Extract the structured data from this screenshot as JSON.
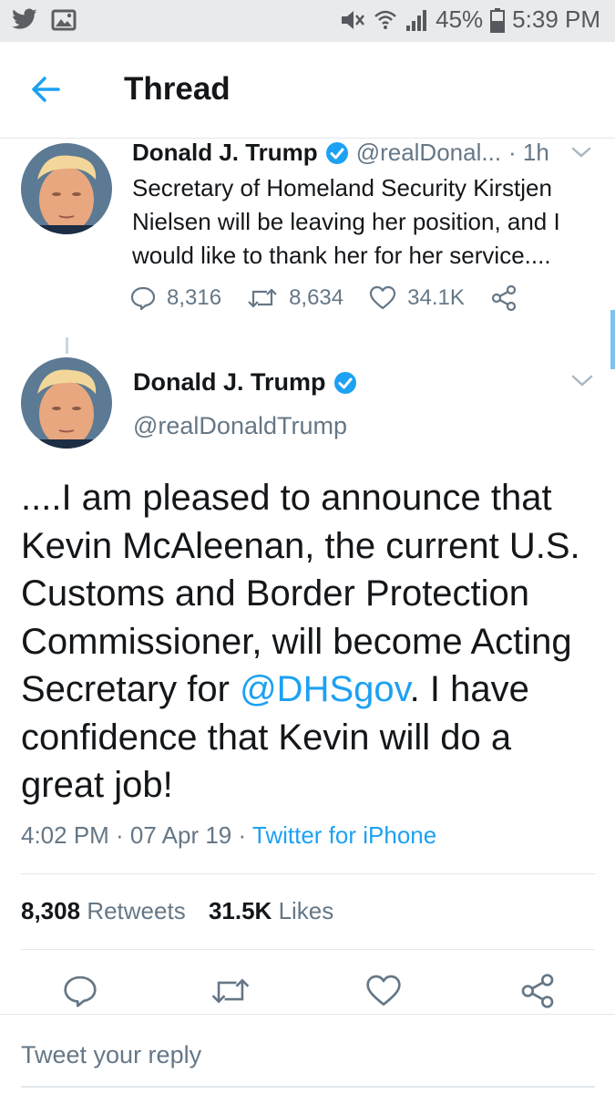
{
  "status_bar": {
    "battery": "45%",
    "time": "5:39 PM"
  },
  "header": {
    "title": "Thread"
  },
  "parent_tweet": {
    "name": "Donald J. Trump",
    "handle": "@realDonal...",
    "time": "· 1h",
    "text": "Secretary of Homeland Security Kirstjen Nielsen will be leaving her position, and I would like to thank her for her service....",
    "replies": "8,316",
    "retweets": "8,634",
    "likes": "34.1K"
  },
  "main_tweet": {
    "name": "Donald J. Trump",
    "handle": "@realDonaldTrump",
    "text_before": "....I am pleased to announce that Kevin McAleenan, the current U.S. Customs and Border Protection Commissioner, will become Acting Secretary for ",
    "mention": "@DHSgov",
    "text_after": ". I have confidence that Kevin will do a great job!",
    "timestamp": "4:02 PM · 07 Apr 19 · ",
    "source": "Twitter for iPhone",
    "retweet_count": "8,308",
    "retweet_label": "Retweets",
    "like_count": "31.5K",
    "like_label": "Likes"
  },
  "reply": {
    "placeholder": "Tweet your reply"
  },
  "colors": {
    "accent": "#1da1f2",
    "muted": "#657786",
    "text": "#14171a",
    "status_bar": "#e9eaeb"
  },
  "icons": [
    "twitter-icon",
    "image-icon",
    "mute-icon",
    "wifi-icon",
    "signal-icon",
    "battery-icon",
    "back-arrow-icon",
    "verified-icon",
    "chevron-down-icon",
    "reply-icon",
    "retweet-icon",
    "like-icon",
    "share-icon"
  ]
}
